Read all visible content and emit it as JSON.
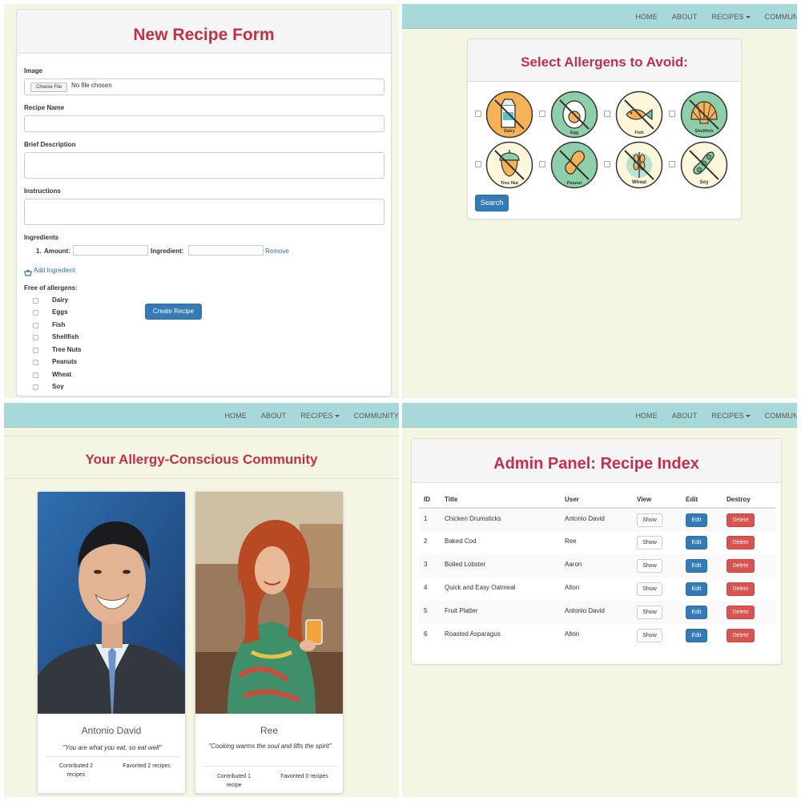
{
  "nav": {
    "items": [
      "HOME",
      "ABOUT",
      "RECIPES",
      "COMMUNITY"
    ]
  },
  "recipe_form": {
    "title": "New Recipe Form",
    "image_label": "Image",
    "file_button": "Choose File",
    "file_status": "No file chosen",
    "recipe_name_label": "Recipe Name",
    "description_label": "Brief Description",
    "instructions_label": "Instructions",
    "ingredients_label": "Ingredients",
    "ingredient_row": {
      "number": "1.",
      "amount_label": "Amount:",
      "ingredient_label": "Ingredient:",
      "remove": "Remove"
    },
    "add_ingredient": "Add Ingredient",
    "allergens_label": "Free of allergens:",
    "allergens": [
      "Dairy",
      "Eggs",
      "Fish",
      "Shellfish",
      "Tree Nuts",
      "Peanuts",
      "Wheat",
      "Soy"
    ],
    "submit": "Create Recipe"
  },
  "allergen_search": {
    "title": "Select Allergens to Avoid:",
    "icons": [
      {
        "label": "Dairy",
        "icon": "milk-carton-icon",
        "bg": "#f7b257"
      },
      {
        "label": "Egg",
        "icon": "egg-icon",
        "bg": "#eef0e4"
      },
      {
        "label": "Fish",
        "icon": "fish-icon",
        "bg": "#fff7dc"
      },
      {
        "label": "Shellfish",
        "icon": "shell-icon",
        "bg": "#8ccfa8"
      },
      {
        "label": "Tree Nut",
        "icon": "acorn-icon",
        "bg": "#fff7dc"
      },
      {
        "label": "Peanut",
        "icon": "peanut-icon",
        "bg": "#8ccfa8"
      },
      {
        "label": "Wheat",
        "icon": "wheat-icon",
        "bg": "#fff7dc"
      },
      {
        "label": "Soy",
        "icon": "soybean-icon",
        "bg": "#fff7dc"
      }
    ],
    "search_button": "Search"
  },
  "community": {
    "title": "Your Allergy-Conscious Community",
    "members": [
      {
        "name": "Antonio David",
        "quote": "\"You are what you eat, so eat well\"",
        "contributed": "Contributed 2 recipes",
        "favorited": "Favorited 2 recipes"
      },
      {
        "name": "Ree",
        "quote": "\"Cooking warms the soul and lifts the spirit\"",
        "contributed": "Contributed 1 recipe",
        "favorited": "Favorited 0 recipes"
      }
    ]
  },
  "admin": {
    "title": "Admin Panel: Recipe Index",
    "columns": [
      "ID",
      "Title",
      "User",
      "View",
      "Edit",
      "Destroy"
    ],
    "rows": [
      {
        "id": "1",
        "title": "Chicken Drumsticks",
        "user": "Antonio David"
      },
      {
        "id": "2",
        "title": "Baked Cod",
        "user": "Ree"
      },
      {
        "id": "3",
        "title": "Boiled Lobster",
        "user": "Aaron"
      },
      {
        "id": "4",
        "title": "Quick and Easy Oatmeal",
        "user": "Alton"
      },
      {
        "id": "5",
        "title": "Fruit Platter",
        "user": "Antonio David"
      },
      {
        "id": "6",
        "title": "Roasted Asparagus",
        "user": "Alton"
      }
    ],
    "show_label": "Show",
    "edit_label": "Edit",
    "delete_label": "Delete"
  },
  "colors": {
    "accent": "#c4304a",
    "nav": "#a8d9da",
    "page_bg": "#f5f5e4",
    "primary": "#337ab7",
    "danger": "#d9534f"
  }
}
